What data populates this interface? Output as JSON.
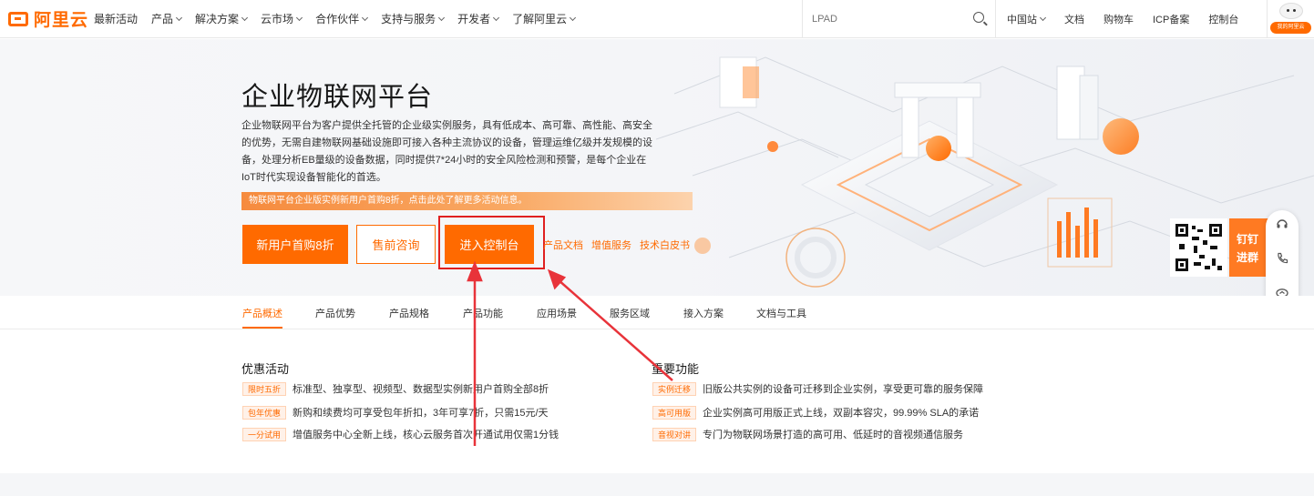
{
  "brand": {
    "name": "阿里云"
  },
  "nav": {
    "items": [
      {
        "label": "最新活动",
        "has_dropdown": false
      },
      {
        "label": "产品",
        "has_dropdown": true
      },
      {
        "label": "解决方案",
        "has_dropdown": true
      },
      {
        "label": "云市场",
        "has_dropdown": true
      },
      {
        "label": "合作伙伴",
        "has_dropdown": true
      },
      {
        "label": "支持与服务",
        "has_dropdown": true
      },
      {
        "label": "开发者",
        "has_dropdown": true
      },
      {
        "label": "了解阿里云",
        "has_dropdown": true
      }
    ],
    "search_placeholder": "LPAD",
    "right": {
      "region": "中国站",
      "docs": "文档",
      "cart": "购物车",
      "icp": "ICP备案",
      "console": "控制台"
    },
    "home_badge": "我的阿里云"
  },
  "hero": {
    "title": "企业物联网平台",
    "description": "企业物联网平台为客户提供全托管的企业级实例服务，具有低成本、高可靠、高性能、高安全的优势，无需自建物联网基础设施即可接入各种主流协议的设备，管理运维亿级并发规模的设备，处理分析EB量级的设备数据，同时提供7*24小时的安全风险检测和预警，是每个企业在IoT时代实现设备智能化的首选。",
    "promo": "物联网平台企业版实例新用户首购8折，点击此处了解更多活动信息。",
    "buttons": {
      "new_user": "新用户首购8折",
      "consult": "售前咨询",
      "console": "进入控制台"
    },
    "links": [
      "产品文档",
      "增值服务",
      "技术白皮书"
    ],
    "qr_cta": [
      "钉钉",
      "进群"
    ]
  },
  "floating": {
    "icons": [
      "headset-icon",
      "phone-icon",
      "cloud-icon",
      "edit-icon"
    ],
    "pill": [
      "上",
      "云",
      "风",
      "向",
      "标"
    ]
  },
  "tabs": [
    {
      "label": "产品概述",
      "active": true
    },
    {
      "label": "产品优势",
      "active": false
    },
    {
      "label": "产品规格",
      "active": false
    },
    {
      "label": "产品功能",
      "active": false
    },
    {
      "label": "应用场景",
      "active": false
    },
    {
      "label": "服务区域",
      "active": false
    },
    {
      "label": "接入方案",
      "active": false
    },
    {
      "label": "文档与工具",
      "active": false
    }
  ],
  "promotions": {
    "title": "优惠活动",
    "items": [
      {
        "tag": "限时五折",
        "text": "标准型、独享型、视频型、数据型实例新用户首购全部8折"
      },
      {
        "tag": "包年优惠",
        "text": "新购和续费均可享受包年折扣，3年可享7折，只需15元/天"
      },
      {
        "tag": "一分试用",
        "text": "增值服务中心全新上线，核心云服务首次开通试用仅需1分钱"
      }
    ]
  },
  "features": {
    "title": "重要功能",
    "items": [
      {
        "tag": "实例迁移",
        "text": "旧版公共实例的设备可迁移到企业实例，享受更可靠的服务保障"
      },
      {
        "tag": "高可用版",
        "text": "企业实例高可用版正式上线，双副本容灾，99.99% SLA的承诺"
      },
      {
        "tag": "音视对讲",
        "text": "专门为物联网场景打造的高可用、低延时的音视频通信服务"
      }
    ]
  },
  "colors": {
    "accent": "#ff6a00",
    "annotation": "#e02020"
  }
}
